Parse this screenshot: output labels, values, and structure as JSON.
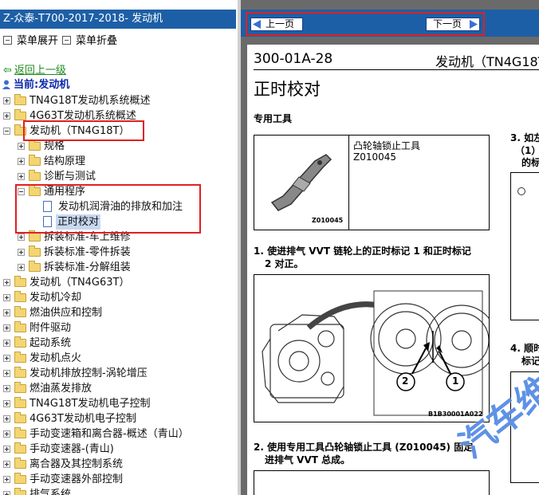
{
  "left": {
    "title": "Z-众泰-T700-2017-2018- 发动机",
    "menu_expand": "菜单展开",
    "menu_collapse": "菜单折叠",
    "back": "返回上一级",
    "current": "当前:发动机",
    "tree": [
      {
        "label": "TN4G18T发动机系统概述",
        "level": 0,
        "exp": "plus",
        "kind": "folder"
      },
      {
        "label": "4G63T发动机系统概述",
        "level": 0,
        "exp": "plus",
        "kind": "folder"
      },
      {
        "label": "发动机（TN4G18T）",
        "level": 0,
        "exp": "minus",
        "kind": "folder"
      },
      {
        "label": "规格",
        "level": 1,
        "exp": "plus",
        "kind": "folder"
      },
      {
        "label": "结构原理",
        "level": 1,
        "exp": "plus",
        "kind": "folder"
      },
      {
        "label": "诊断与测试",
        "level": 1,
        "exp": "plus",
        "kind": "folder"
      },
      {
        "label": "通用程序",
        "level": 1,
        "exp": "minus",
        "kind": "folder"
      },
      {
        "label": "发动机润滑油的排放和加注",
        "level": 2,
        "exp": "",
        "kind": "doc"
      },
      {
        "label": "正时校对",
        "level": 2,
        "exp": "",
        "kind": "doc",
        "selected": true
      },
      {
        "label": "拆装标准-车上维修",
        "level": 1,
        "exp": "plus",
        "kind": "folder"
      },
      {
        "label": "拆装标准-零件拆装",
        "level": 1,
        "exp": "plus",
        "kind": "folder"
      },
      {
        "label": "拆装标准-分解组装",
        "level": 1,
        "exp": "plus",
        "kind": "folder"
      },
      {
        "label": "发动机（TN4G63T）",
        "level": 0,
        "exp": "plus",
        "kind": "folder"
      },
      {
        "label": "发动机冷却",
        "level": 0,
        "exp": "plus",
        "kind": "folder"
      },
      {
        "label": "燃油供应和控制",
        "level": 0,
        "exp": "plus",
        "kind": "folder"
      },
      {
        "label": "附件驱动",
        "level": 0,
        "exp": "plus",
        "kind": "folder"
      },
      {
        "label": "起动系统",
        "level": 0,
        "exp": "plus",
        "kind": "folder"
      },
      {
        "label": "发动机点火",
        "level": 0,
        "exp": "plus",
        "kind": "folder"
      },
      {
        "label": "发动机排放控制-涡轮增压",
        "level": 0,
        "exp": "plus",
        "kind": "folder"
      },
      {
        "label": "燃油蒸发排放",
        "level": 0,
        "exp": "plus",
        "kind": "folder"
      },
      {
        "label": "TN4G18T发动机电子控制",
        "level": 0,
        "exp": "plus",
        "kind": "folder"
      },
      {
        "label": "4G63T发动机电子控制",
        "level": 0,
        "exp": "plus",
        "kind": "folder"
      },
      {
        "label": "手动变速箱和离合器-概述（青山）",
        "level": 0,
        "exp": "plus",
        "kind": "folder"
      },
      {
        "label": "手动变速器-(青山)",
        "level": 0,
        "exp": "plus",
        "kind": "folder"
      },
      {
        "label": "离合器及其控制系统",
        "level": 0,
        "exp": "plus",
        "kind": "folder"
      },
      {
        "label": "手动变速器外部控制",
        "level": 0,
        "exp": "plus",
        "kind": "folder"
      },
      {
        "label": "排气系统",
        "level": 0,
        "exp": "plus",
        "kind": "folder"
      }
    ]
  },
  "right": {
    "prev": "上一页",
    "next": "下一页",
    "doc_code": "300-01A-28",
    "doc_section": "发动机（TN4G18T）",
    "doc_title": "正时校对",
    "tools_heading": "专用工具",
    "tool_name": "凸轮轴锁止工具",
    "tool_code": "Z010045",
    "tool_img_code": "Z010045",
    "step1": "1. 使进排气 VVT 链轮上的正时标记 1 和正时标记",
    "step1b": "2 对正。",
    "fig1_code": "B1B30001A022",
    "callout1": "1",
    "callout2": "2",
    "step2": "2. 使用专用工具凸轮轴锁止工具 (Z010045) 固定",
    "step2b": "进排气 VVT 总成。",
    "step3a": "3. 如左",
    "step3b": "（1）",
    "step3c": "的标",
    "step4a": "4. 顺时",
    "step4b": "标记",
    "watermark": "汽车维"
  },
  "colors": {
    "titlebar": "#1d5fa6",
    "highlight": "#e02020",
    "watermark": "#2e6ed8"
  }
}
